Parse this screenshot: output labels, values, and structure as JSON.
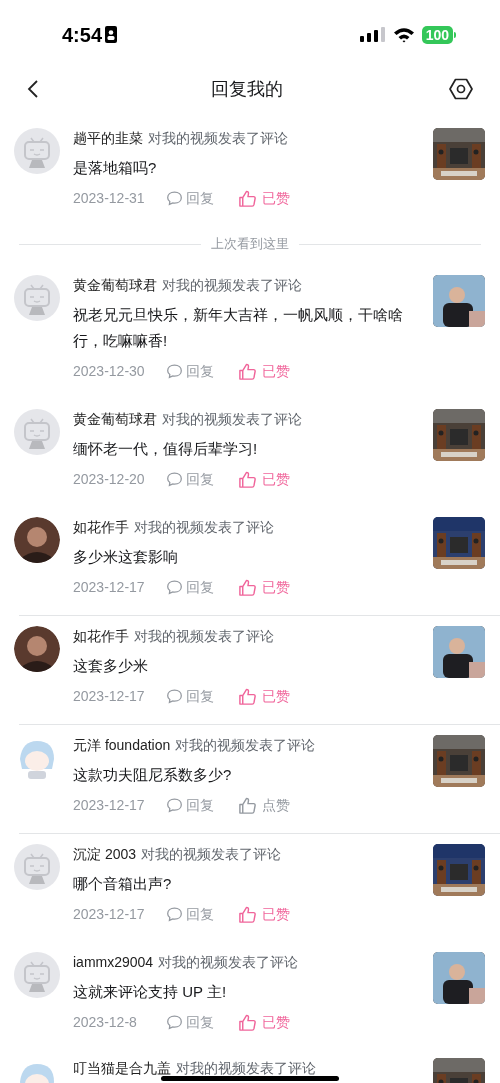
{
  "status_bar": {
    "time": "4:54",
    "battery": "100"
  },
  "header": {
    "title": "回复我的"
  },
  "items": [
    {
      "kind": "comment",
      "avatar": {
        "kind": "default"
      },
      "name": "趟平的韭菜",
      "action": "对我的视频发表了评论",
      "body": "是落地箱吗?",
      "date": "2023-12-31",
      "reply": "回复",
      "liked": true,
      "like_label": "已赞",
      "separator": false
    },
    {
      "kind": "marker",
      "label": "上次看到这里"
    },
    {
      "kind": "comment",
      "avatar": {
        "kind": "default"
      },
      "name": "黄金葡萄球君",
      "action": "对我的视频发表了评论",
      "body": "祝老兄元旦快乐，新年大吉祥，一帆风顺，干啥啥行，吃嘛嘛香!",
      "date": "2023-12-30",
      "reply": "回复",
      "liked": true,
      "like_label": "已赞",
      "separator": false
    },
    {
      "kind": "comment",
      "avatar": {
        "kind": "default"
      },
      "name": "黄金葡萄球君",
      "action": "对我的视频发表了评论",
      "body": "缅怀老一代，值得后辈学习!",
      "date": "2023-12-20",
      "reply": "回复",
      "liked": true,
      "like_label": "已赞",
      "separator": false
    },
    {
      "kind": "comment",
      "name": "如花作手",
      "action": "对我的视频发表了评论",
      "body": "多少米这套影响",
      "date": "2023-12-17",
      "reply": "回复",
      "liked": true,
      "like_label": "已赞",
      "separator": true
    },
    {
      "kind": "comment",
      "name": "如花作手",
      "action": "对我的视频发表了评论",
      "body": "这套多少米",
      "date": "2023-12-17",
      "reply": "回复",
      "liked": true,
      "like_label": "已赞",
      "separator": true
    },
    {
      "kind": "comment",
      "avatar": {
        "kind": "anime"
      },
      "name": "元洋 foundation",
      "action": "对我的视频发表了评论",
      "body": "这款功夫阻尼系数多少?",
      "date": "2023-12-17",
      "reply": "回复",
      "liked": false,
      "like_label": "点赞",
      "separator": true
    },
    {
      "kind": "comment",
      "avatar": {
        "kind": "default"
      },
      "name": "沉淀 2003",
      "action": "对我的视频发表了评论",
      "body": "哪个音箱出声?",
      "date": "2023-12-17",
      "reply": "回复",
      "liked": true,
      "like_label": "已赞",
      "separator": false
    },
    {
      "kind": "comment",
      "avatar": {
        "kind": "default"
      },
      "name": "iammx29004",
      "action": "对我的视频发表了评论",
      "body": "这就来评论支持 UP 主!",
      "date": "2023-12-8",
      "reply": "回复",
      "liked": true,
      "like_label": "已赞",
      "separator": false
    },
    {
      "kind": "comment",
      "avatar": {
        "kind": "anime"
      },
      "name": "叮当猫是合九盖",
      "action": "对我的视频发表了评论"
    }
  ]
}
